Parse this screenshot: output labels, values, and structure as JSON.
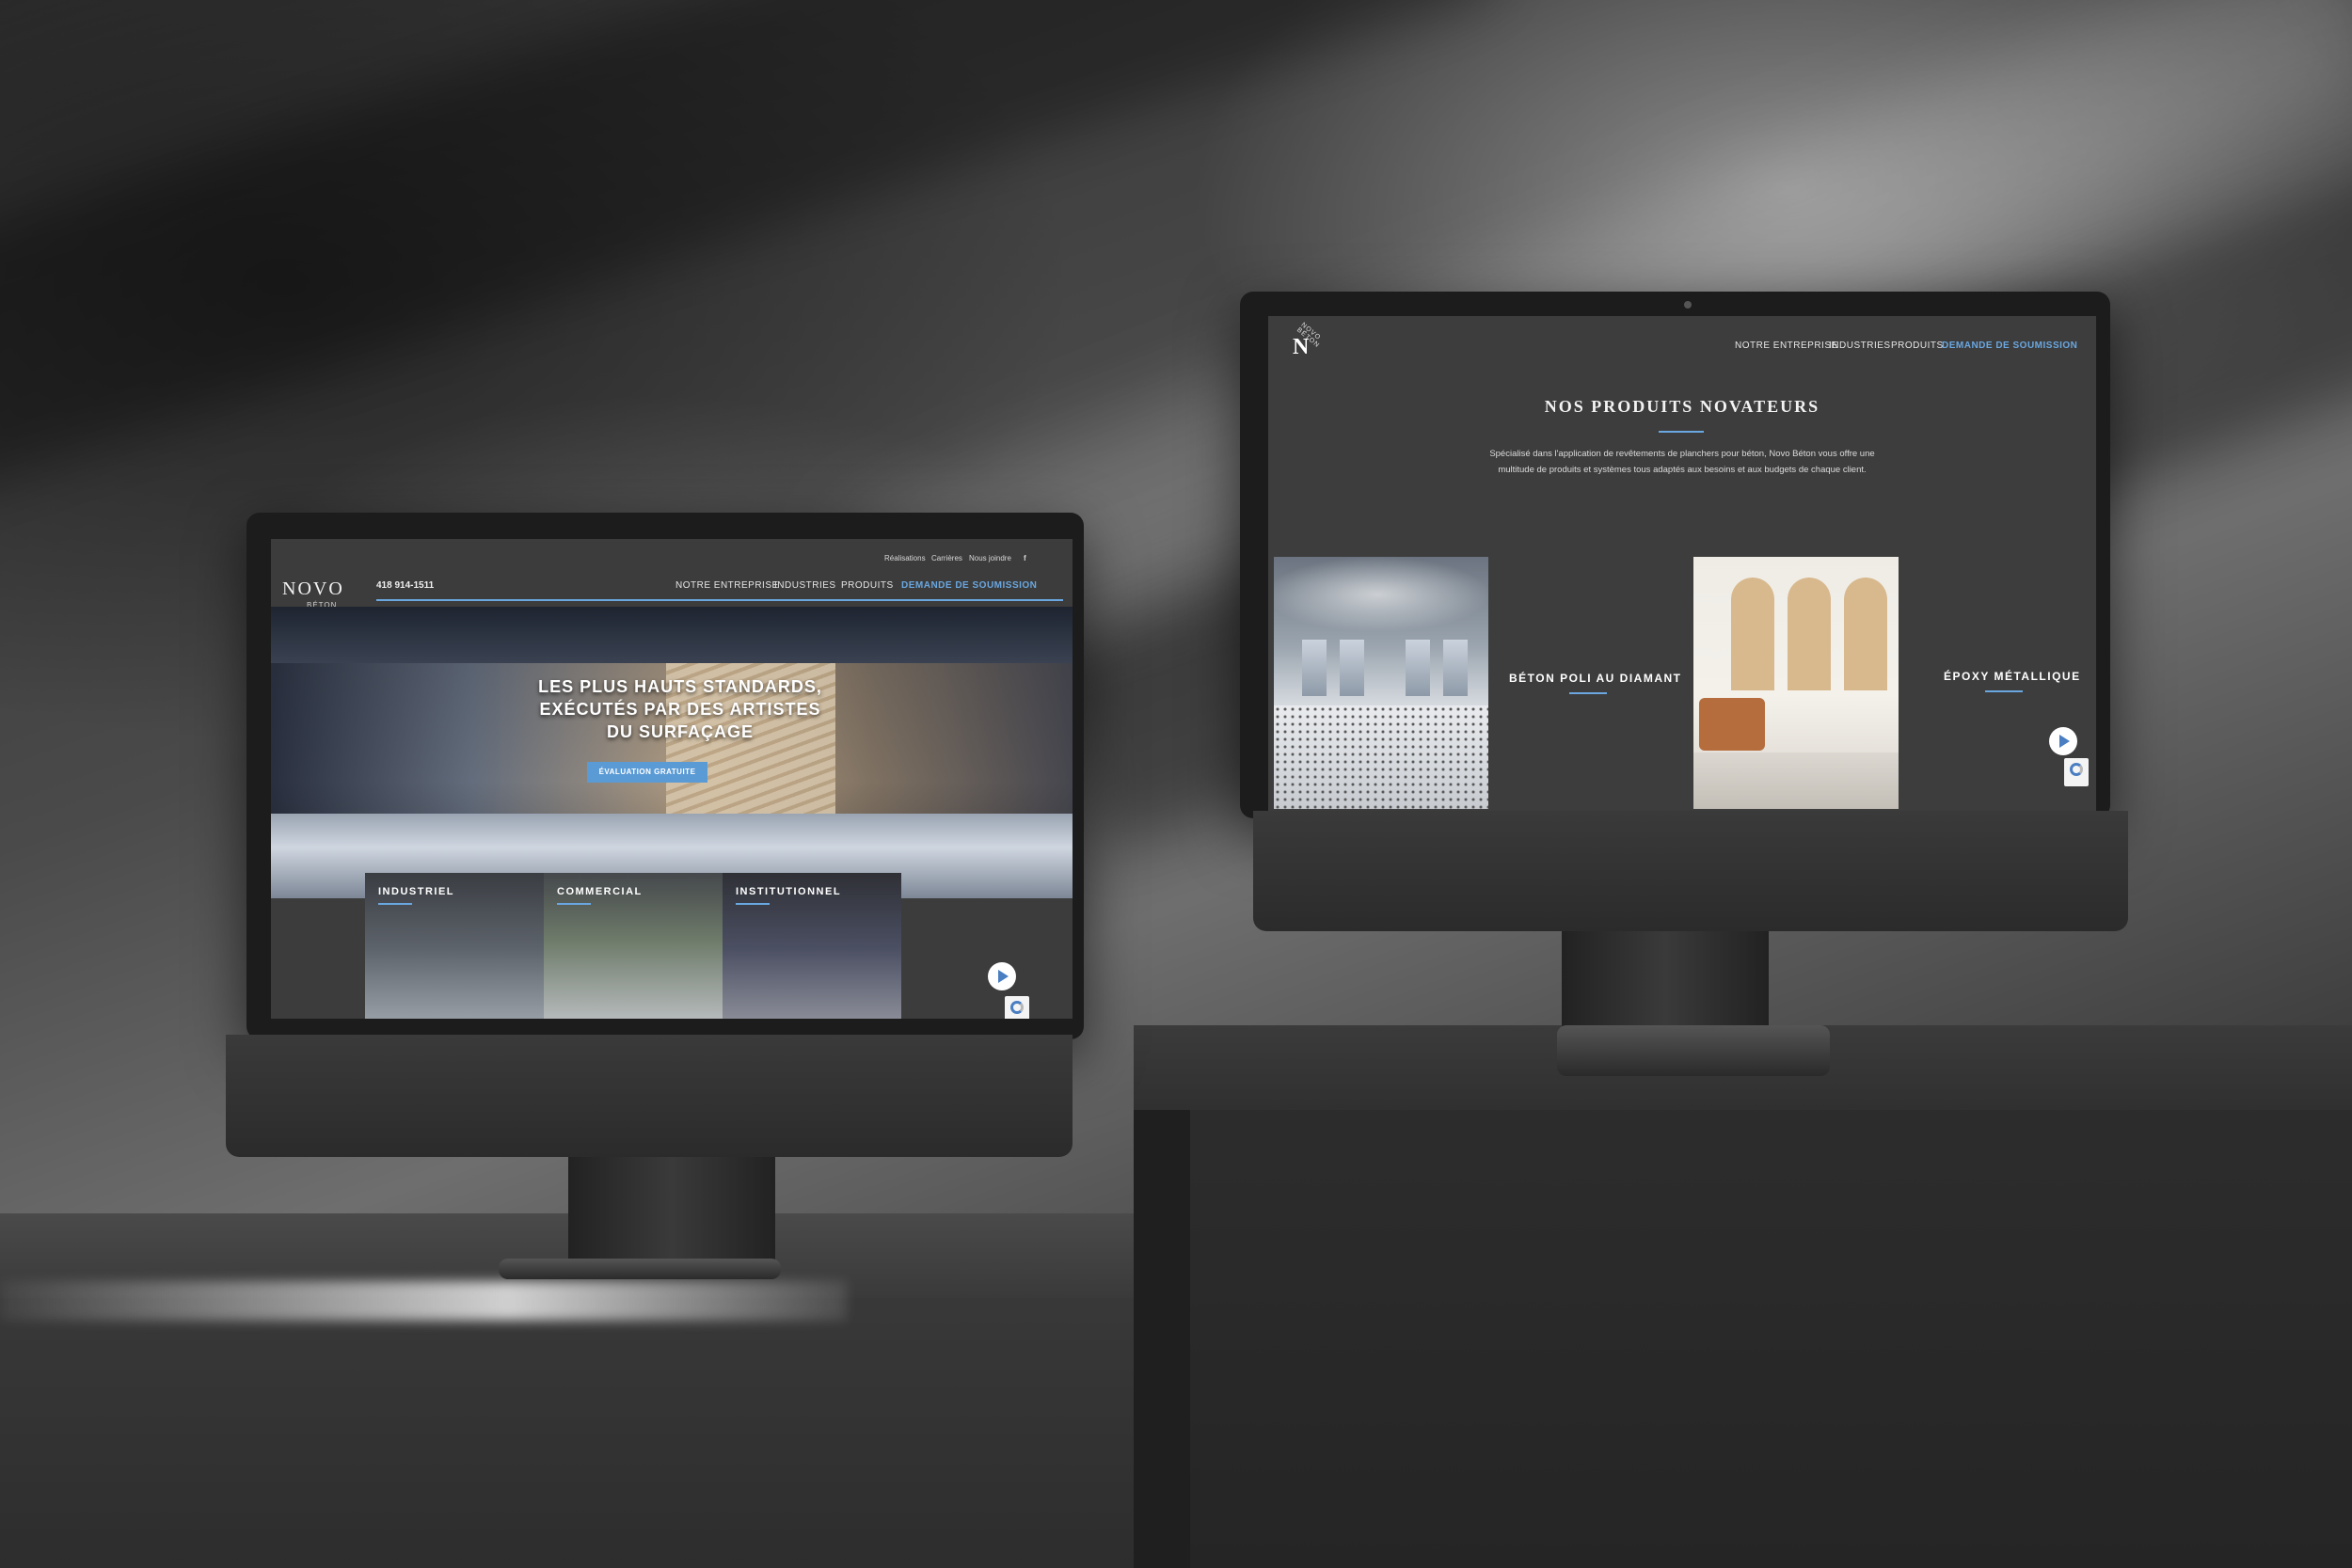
{
  "left_site": {
    "top_links": [
      "Réalisations",
      "Carrières",
      "Nous joindre"
    ],
    "social_icon": "facebook-icon",
    "logo": "NOVO",
    "logo_sub": "BÉTON",
    "phone": "418 914-1511",
    "nav": [
      "NOTRE ENTREPRISE",
      "INDUSTRIES",
      "PRODUITS",
      "DEMANDE DE SOUMISSION"
    ],
    "hero_headline_lines": [
      "LES PLUS HAUTS STANDARDS,",
      "EXÉCUTÉS PAR DES ARTISTES",
      "DU SURFAÇAGE"
    ],
    "cta_label": "ÉVALUATION GRATUITE",
    "cards": [
      "INDUSTRIEL",
      "COMMERCIAL",
      "INSTITUTIONNEL"
    ]
  },
  "right_site": {
    "logo_letter": "N",
    "logo_text": "NOVO BÉTON",
    "nav": [
      "NOTRE ENTREPRISE",
      "INDUSTRIES",
      "PRODUITS",
      "DEMANDE DE SOUMISSION"
    ],
    "title": "NOS PRODUITS NOVATEURS",
    "intro_lines": [
      "Spécialisé dans l'application de revêtements de planchers pour béton, Novo Béton vous offre une",
      "multitude de produits et systèmes tous adaptés aux besoins et aux budgets de chaque client."
    ],
    "products": [
      "BÉTON POLI AU DIAMANT",
      "ÉPOXY MÉTALLIQUE"
    ]
  },
  "colors": {
    "accent": "#6aa7e0",
    "cta": "#5b9bd5",
    "site_bg": "#3d3d3d"
  }
}
